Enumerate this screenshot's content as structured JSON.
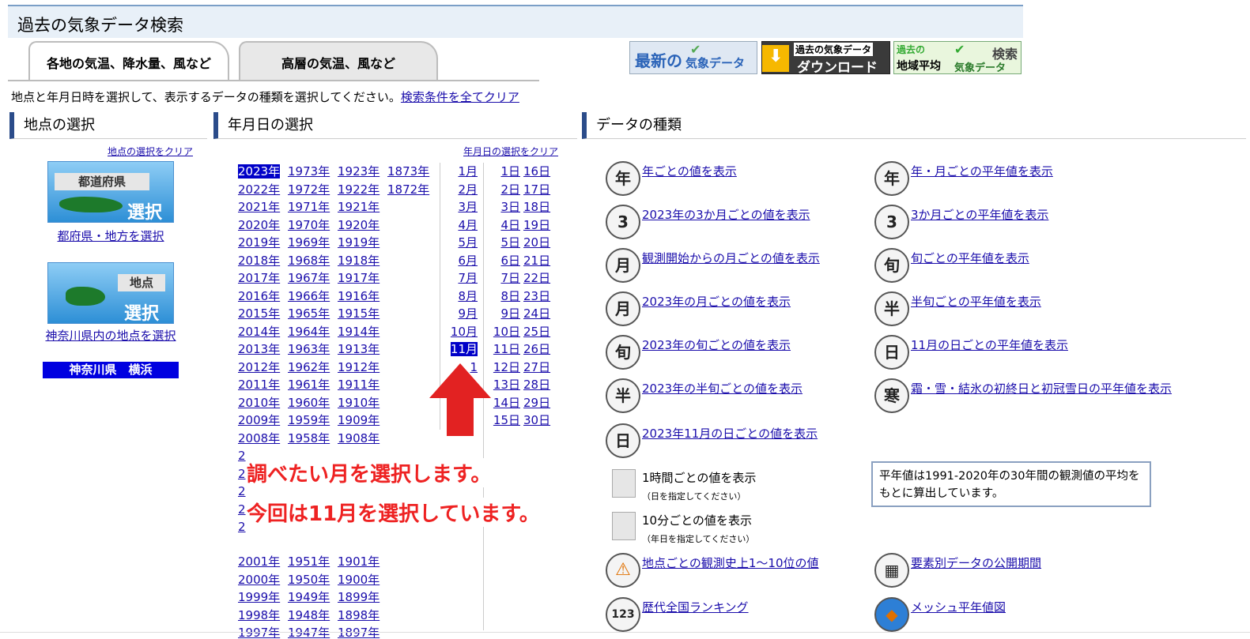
{
  "header": {
    "title": "過去の気象データ検索"
  },
  "tabs": [
    {
      "label": "各地の気温、降水量、風など"
    },
    {
      "label": "高層の気温、風など"
    }
  ],
  "banners": {
    "latest_main": "最新の",
    "latest_sub": "気象データ",
    "download_top": "過去の気象データ",
    "download_bottom": "ダウンロード",
    "regional_top": "過去の",
    "regional_main": "地域平均",
    "regional_sub": "気象データ",
    "regional_right": "検索"
  },
  "instruction": {
    "text": "地点と年月日時を選択して、表示するデータの種類を選択してください。",
    "clear_all": "検索条件を全てクリア"
  },
  "sections": {
    "station": {
      "title": "地点の選択",
      "clear": "地点の選択をクリア"
    },
    "date": {
      "title": "年月日の選択",
      "clear": "年月日の選択をクリア"
    },
    "datatype": {
      "title": "データの種類"
    }
  },
  "station": {
    "pref_img_top": "都道府県",
    "pref_img_bottom": "選択",
    "pref_link": "都府県・地方を選択",
    "point_img_top": "地点",
    "point_img_bottom": "選択",
    "point_link": "神奈川県内の地点を選択",
    "selected": "神奈川県　横浜"
  },
  "years": {
    "col1": [
      "2023年",
      "2022年",
      "2021年",
      "2020年",
      "2019年",
      "2018年",
      "2017年",
      "2016年",
      "2015年",
      "2014年",
      "2013年",
      "2012年",
      "2011年",
      "2010年",
      "2009年",
      "2008年"
    ],
    "col1_partial": [
      "2",
      "2",
      "2",
      "2",
      "2"
    ],
    "col1_bottom": [
      "2001年",
      "2000年",
      "1999年",
      "1998年",
      "1997年"
    ],
    "col2": [
      "1973年",
      "1972年",
      "1971年",
      "1970年",
      "1969年",
      "1968年",
      "1967年",
      "1966年",
      "1965年",
      "1964年",
      "1963年",
      "1962年",
      "1961年",
      "1960年",
      "1959年",
      "1958年"
    ],
    "col2_bottom": [
      "1951年",
      "1950年",
      "1949年",
      "1948年",
      "1947年"
    ],
    "col3": [
      "1923年",
      "1922年",
      "1921年",
      "1920年",
      "1919年",
      "1918年",
      "1917年",
      "1916年",
      "1915年",
      "1914年",
      "1913年",
      "1912年",
      "1911年",
      "1910年",
      "1909年",
      "1908年"
    ],
    "col3_bottom": [
      "1901年",
      "1900年",
      "1899年",
      "1898年",
      "1897年"
    ],
    "col4": [
      "1873年",
      "1872年"
    ],
    "selected": "2023年"
  },
  "months": [
    "1月",
    "2月",
    "3月",
    "4月",
    "5月",
    "6月",
    "7月",
    "8月",
    "9月",
    "10月",
    "11月",
    "1",
    "",
    "",
    "",
    ""
  ],
  "selected_month": "11月",
  "days_col1": [
    "1日",
    "2日",
    "3日",
    "4日",
    "5日",
    "6日",
    "7日",
    "8日",
    "9日",
    "10日",
    "11日",
    "12日",
    "13日",
    "14日",
    "15日"
  ],
  "days_col2": [
    "16日",
    "17日",
    "18日",
    "19日",
    "20日",
    "21日",
    "22日",
    "23日",
    "24日",
    "25日",
    "26日",
    "27日",
    "28日",
    "29日",
    "30日"
  ],
  "callout": {
    "line1": "調べたい月を選択します。",
    "line2": "今回は11月を選択しています。"
  },
  "datatypes": {
    "left": [
      {
        "icon": "年",
        "label": "年ごとの値を表示"
      },
      {
        "icon": "3",
        "label": "2023年の3か月ごとの値を表示"
      },
      {
        "icon": "月",
        "label": "観測開始からの月ごとの値を表示"
      },
      {
        "icon": "月",
        "label": "2023年の月ごとの値を表示"
      },
      {
        "icon": "旬",
        "label": "2023年の旬ごとの値を表示"
      },
      {
        "icon": "半",
        "label": "2023年の半旬ごとの値を表示"
      },
      {
        "icon": "日",
        "label": "2023年11月の日ごとの値を表示"
      }
    ],
    "right": [
      {
        "icon": "年",
        "label": "年・月ごとの平年値を表示"
      },
      {
        "icon": "3",
        "label": "3か月ごとの平年値を表示"
      },
      {
        "icon": "旬",
        "label": "旬ごとの平年値を表示"
      },
      {
        "icon": "半",
        "label": "半旬ごとの平年値を表示"
      },
      {
        "icon": "日",
        "label": "11月の日ごとの平年値を表示"
      },
      {
        "icon": "寒",
        "label": "霜・雪・結氷の初終日と初冠雪日の平年値を表示"
      }
    ],
    "hourly": {
      "label": "1時間ごとの値を表示",
      "note": "（日を指定してください）"
    },
    "tenmin": {
      "label": "10分ごとの値を表示",
      "note": "（年日を指定してください）"
    },
    "top10": "地点ごとの観測史上1～10位の値",
    "ranking": "歴代全国ランキング",
    "period": "要素別データの公開期間",
    "mesh": "メッシュ平年値図"
  },
  "note_box": "平年値は1991-2020年の30年間の観測値の平均をもとに算出しています。",
  "colors": {
    "accent": "#2b4c8a",
    "selected": "#0000c8",
    "callout": "#e22222",
    "link": "#1a0dab"
  }
}
